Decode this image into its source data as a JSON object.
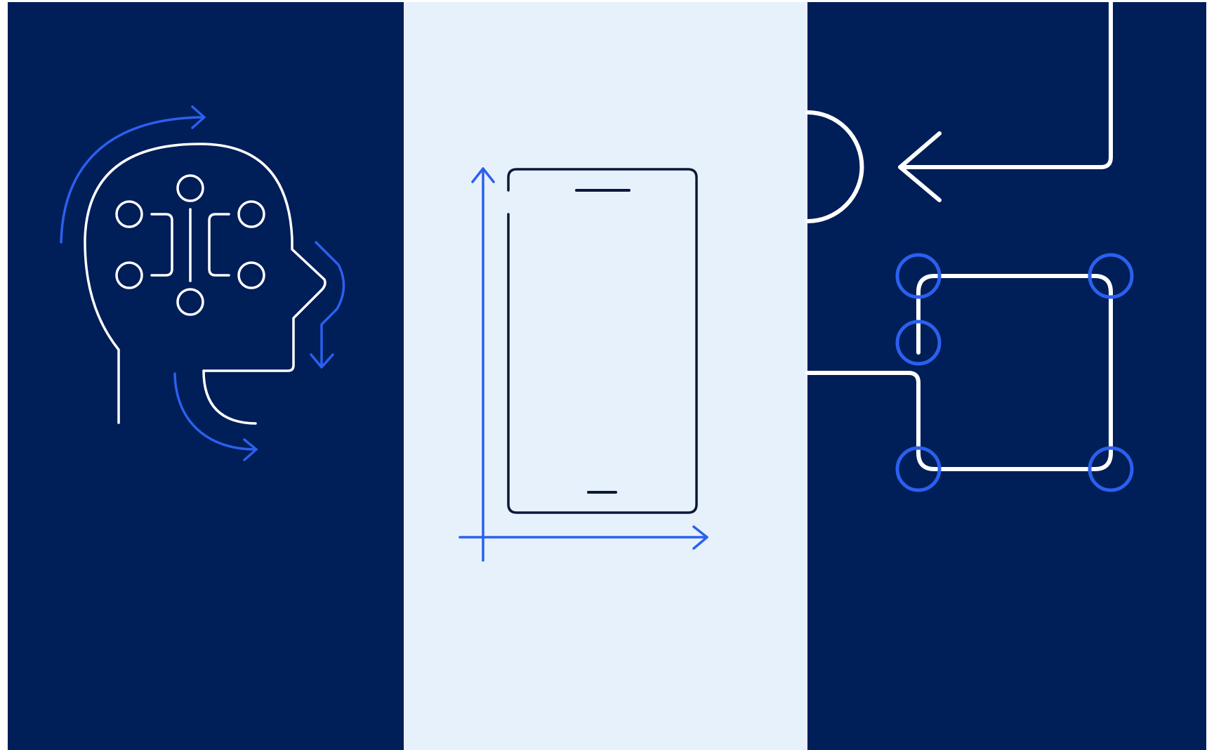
{
  "colors": {
    "navy": "#001E58",
    "light_panel": "#E7F1FB",
    "accent_blue": "#2B60EE",
    "white": "#FFFFFF",
    "ink": "#0B1838"
  },
  "panels": [
    {
      "name": "panel-left-ai-head",
      "icon": "ai-head-circuit-icon"
    },
    {
      "name": "panel-center-mobile",
      "icon": "mobile-device-axes-icon"
    },
    {
      "name": "panel-right-workflow",
      "icon": "workflow-connector-icon"
    }
  ]
}
